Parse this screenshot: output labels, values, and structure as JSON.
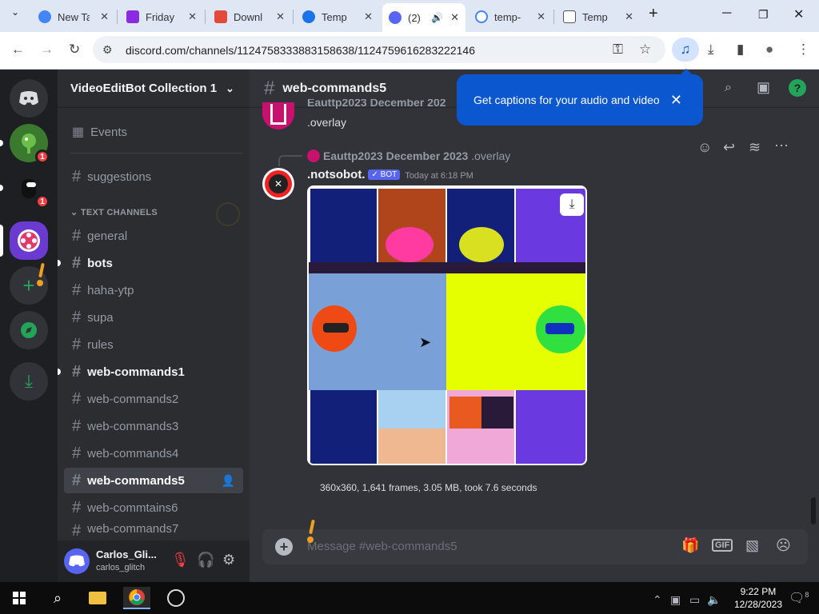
{
  "browser": {
    "tabs": [
      {
        "title": "New Ta",
        "icon": "chrome-icon"
      },
      {
        "title": "Friday",
        "icon": "fnf-icon"
      },
      {
        "title": "Downl",
        "icon": "download-site-icon"
      },
      {
        "title": "Temp",
        "icon": "temp-icon"
      },
      {
        "title": "(2)",
        "icon": "discord-icon",
        "active": true
      },
      {
        "title": "temp-",
        "icon": "google-icon"
      },
      {
        "title": "Temp",
        "icon": "mail-icon"
      }
    ],
    "url": "discord.com/channels/1124758333883158638/1124759616283222146",
    "new_tab": "+",
    "close": "✕"
  },
  "servers": [
    {
      "name": "Discord home",
      "badge": ""
    },
    {
      "name": "Server 1",
      "badge": "1"
    },
    {
      "name": "Server 2",
      "badge": "1"
    },
    {
      "name": "VideoEditBot",
      "badge": ""
    }
  ],
  "sidebar": {
    "server_name": "VideoEditBot Collection 1.0",
    "events": "Events",
    "suggestions": "suggestions",
    "category": "TEXT CHANNELS",
    "channels": [
      {
        "name": "general",
        "state": "normal"
      },
      {
        "name": "bots",
        "state": "unread"
      },
      {
        "name": "haha-ytp",
        "state": "normal"
      },
      {
        "name": "supa",
        "state": "normal"
      },
      {
        "name": "rules",
        "state": "normal"
      },
      {
        "name": "web-commands1",
        "state": "unread"
      },
      {
        "name": "web-commands2",
        "state": "normal"
      },
      {
        "name": "web-commands3",
        "state": "normal"
      },
      {
        "name": "web-commands4",
        "state": "normal"
      },
      {
        "name": "web-commands5",
        "state": "selected"
      },
      {
        "name": "web-commtains6",
        "state": "normal"
      },
      {
        "name": "web-commands7",
        "state": "normal"
      }
    ],
    "user": {
      "display": "Carlos_Gli...",
      "tag": "carlos_glitch"
    }
  },
  "channel": {
    "title": "web-commands5",
    "popup": "Get captions for your audio and video"
  },
  "messages": {
    "prev_author": "Eauttp2023 December 202",
    "prev_text": ".overlay",
    "reply_author": "Eauttp2023 December 2023",
    "reply_text": ".overlay",
    "author": ".notsobot.",
    "bot_tag": "BOT",
    "timestamp": "Today at 6:18 PM",
    "attachment_info": "360x360, 1,641 frames, 3.05 MB, took 7.6 seconds"
  },
  "composer": {
    "placeholder": "Message #web-commands5"
  },
  "taskbar": {
    "time": "9:22 PM",
    "date": "12/28/2023",
    "notif": "8"
  }
}
